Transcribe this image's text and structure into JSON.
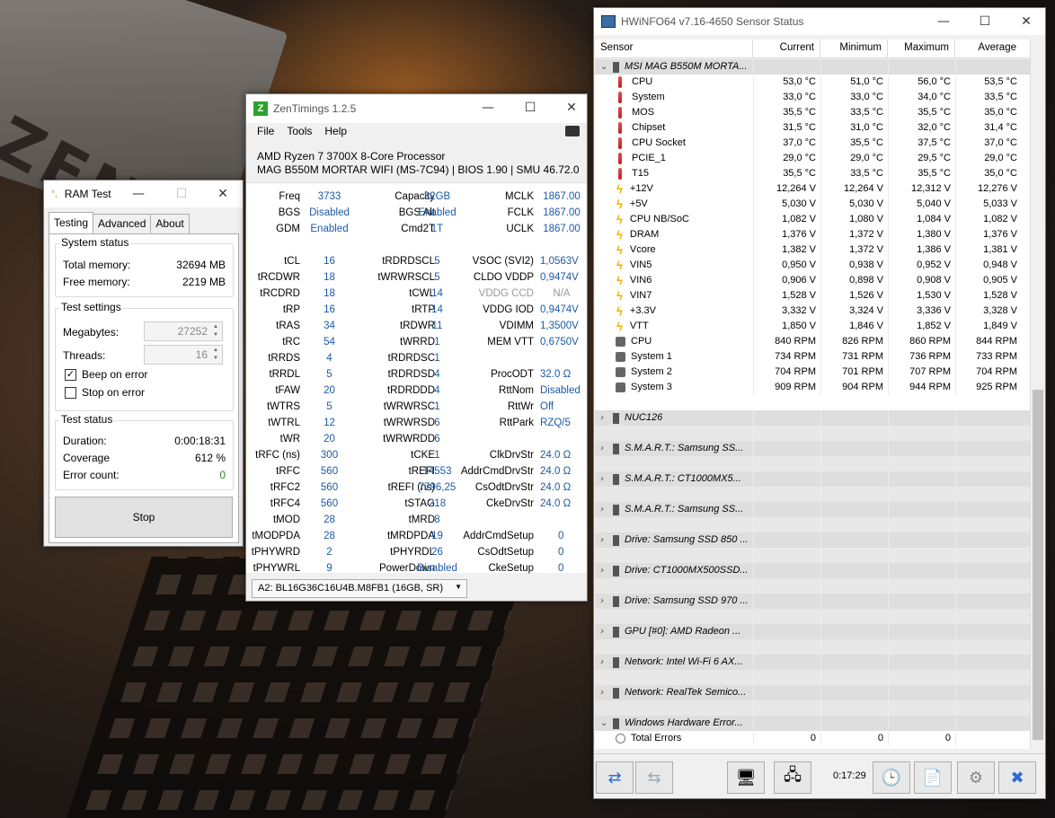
{
  "ramtest": {
    "title": "RAM Test",
    "tabs": [
      "Testing",
      "Advanced",
      "About"
    ],
    "system_status": {
      "title": "System status",
      "total_label": "Total memory:",
      "total_value": "32694 MB",
      "free_label": "Free memory:",
      "free_value": "2219 MB"
    },
    "settings": {
      "title": "Test settings",
      "mb_label": "Megabytes:",
      "mb_value": "27252",
      "threads_label": "Threads:",
      "threads_value": "16",
      "beep_label": "Beep on error",
      "beep_checked": true,
      "stop_label": "Stop on error",
      "stop_checked": false
    },
    "status": {
      "title": "Test status",
      "dur_label": "Duration:",
      "dur_value": "0:00:18:31",
      "cov_label": "Coverage",
      "cov_value": "612 %",
      "err_label": "Error count:",
      "err_value": "0"
    },
    "stop_button": "Stop"
  },
  "zen": {
    "title": "ZenTimings 1.2.5",
    "menu": [
      "File",
      "Tools",
      "Help"
    ],
    "cpu": "AMD Ryzen 7 3700X 8-Core Processor",
    "board": "MAG B550M MORTAR WIFI (MS-7C94) | BIOS 1.90 | SMU 46.72.0",
    "rows": [
      [
        "Freq",
        "3733",
        "Capacity",
        "32GB",
        "MCLK",
        "1867.00"
      ],
      [
        "BGS",
        "Disabled",
        "BGS Alt",
        "Enabled",
        "FCLK",
        "1867.00"
      ],
      [
        "GDM",
        "Enabled",
        "Cmd2T",
        "1T",
        "UCLK",
        "1867.00"
      ],
      [
        "",
        "",
        "",
        "",
        "",
        ""
      ],
      [
        "tCL",
        "16",
        "tRDRDSCL",
        "5",
        "VSOC (SVI2)",
        "1,0563V"
      ],
      [
        "tRCDWR",
        "18",
        "tWRWRSCL",
        "5",
        "CLDO VDDP",
        "0,9474V"
      ],
      [
        "tRCDRD",
        "18",
        "tCWL",
        "14",
        "VDDG CCD",
        "N/A"
      ],
      [
        "tRP",
        "16",
        "tRTP",
        "14",
        "VDDG IOD",
        "0,9474V"
      ],
      [
        "tRAS",
        "34",
        "tRDWR",
        "11",
        "VDIMM",
        "1,3500V"
      ],
      [
        "tRC",
        "54",
        "tWRRD",
        "1",
        "MEM VTT",
        "0,6750V"
      ],
      [
        "tRRDS",
        "4",
        "tRDRDSC",
        "1",
        "",
        ""
      ],
      [
        "tRRDL",
        "5",
        "tRDRDSD",
        "4",
        "ProcODT",
        "32.0 Ω"
      ],
      [
        "tFAW",
        "20",
        "tRDRDDD",
        "4",
        "RttNom",
        "Disabled"
      ],
      [
        "tWTRS",
        "5",
        "tWRWRSC",
        "1",
        "RttWr",
        "Off"
      ],
      [
        "tWTRL",
        "12",
        "tWRWRSD",
        "6",
        "RttPark",
        "RZQ/5"
      ],
      [
        "tWR",
        "20",
        "tWRWRDD",
        "6",
        "",
        ""
      ],
      [
        "tRFC (ns)",
        "300",
        "tCKE",
        "1",
        "ClkDrvStr",
        "24.0 Ω"
      ],
      [
        "tRFC",
        "560",
        "tREFI",
        "14553",
        "AddrCmdDrvStr",
        "24.0 Ω"
      ],
      [
        "tRFC2",
        "560",
        "tREFI (ns)",
        "7796,25",
        "CsOdtDrvStr",
        "24.0 Ω"
      ],
      [
        "tRFC4",
        "560",
        "tSTAG",
        "218",
        "CkeDrvStr",
        "24.0 Ω"
      ],
      [
        "tMOD",
        "28",
        "tMRD",
        "8",
        "",
        ""
      ],
      [
        "tMODPDA",
        "28",
        "tMRDPDA",
        "19",
        "AddrCmdSetup",
        "0"
      ],
      [
        "tPHYWRD",
        "2",
        "tPHYRDL",
        "26",
        "CsOdtSetup",
        "0"
      ],
      [
        "tPHYWRL",
        "9",
        "PowerDown",
        "Disabled",
        "CkeSetup",
        "0"
      ]
    ],
    "dimm": "A2: BL16G36C16U4B.M8FB1 (16GB, SR)"
  },
  "hw": {
    "title": "HWiNFO64 v7.16-4650 Sensor Status",
    "columns": [
      "Sensor",
      "Current",
      "Minimum",
      "Maximum",
      "Average"
    ],
    "board": "MSI MAG B550M MORTA...",
    "sensors": [
      [
        "t",
        "CPU",
        "53,0 °C",
        "51,0 °C",
        "56,0 °C",
        "53,5 °C"
      ],
      [
        "t",
        "System",
        "33,0 °C",
        "33,0 °C",
        "34,0 °C",
        "33,5 °C"
      ],
      [
        "t",
        "MOS",
        "35,5 °C",
        "33,5 °C",
        "35,5 °C",
        "35,0 °C"
      ],
      [
        "t",
        "Chipset",
        "31,5 °C",
        "31,0 °C",
        "32,0 °C",
        "31,4 °C"
      ],
      [
        "t",
        "CPU Socket",
        "37,0 °C",
        "35,5 °C",
        "37,5 °C",
        "37,0 °C"
      ],
      [
        "t",
        "PCIE_1",
        "29,0 °C",
        "29,0 °C",
        "29,5 °C",
        "29,0 °C"
      ],
      [
        "t",
        "T15",
        "35,5 °C",
        "33,5 °C",
        "35,5 °C",
        "35,0 °C"
      ],
      [
        "v",
        "+12V",
        "12,264 V",
        "12,264 V",
        "12,312 V",
        "12,276 V"
      ],
      [
        "v",
        "+5V",
        "5,030 V",
        "5,030 V",
        "5,040 V",
        "5,033 V"
      ],
      [
        "v",
        "CPU NB/SoC",
        "1,082 V",
        "1,080 V",
        "1,084 V",
        "1,082 V"
      ],
      [
        "v",
        "DRAM",
        "1,376 V",
        "1,372 V",
        "1,380 V",
        "1,376 V"
      ],
      [
        "v",
        "Vcore",
        "1,382 V",
        "1,372 V",
        "1,386 V",
        "1,381 V"
      ],
      [
        "v",
        "VIN5",
        "0,950 V",
        "0,938 V",
        "0,952 V",
        "0,948 V"
      ],
      [
        "v",
        "VIN6",
        "0,906 V",
        "0,898 V",
        "0,908 V",
        "0,905 V"
      ],
      [
        "v",
        "VIN7",
        "1,528 V",
        "1,526 V",
        "1,530 V",
        "1,528 V"
      ],
      [
        "v",
        "+3.3V",
        "3,332 V",
        "3,324 V",
        "3,336 V",
        "3,328 V"
      ],
      [
        "v",
        "VTT",
        "1,850 V",
        "1,846 V",
        "1,852 V",
        "1,849 V"
      ],
      [
        "f",
        "CPU",
        "840 RPM",
        "826 RPM",
        "860 RPM",
        "844 RPM"
      ],
      [
        "f",
        "System 1",
        "734 RPM",
        "731 RPM",
        "736 RPM",
        "733 RPM"
      ],
      [
        "f",
        "System 2",
        "704 RPM",
        "701 RPM",
        "707 RPM",
        "704 RPM"
      ],
      [
        "f",
        "System 3",
        "909 RPM",
        "904 RPM",
        "944 RPM",
        "925 RPM"
      ]
    ],
    "groups": [
      "NUC126",
      "S.M.A.R.T.: Samsung SS...",
      "S.M.A.R.T.: CT1000MX5...",
      "S.M.A.R.T.: Samsung SS...",
      "Drive: Samsung SSD 850 ...",
      "Drive: CT1000MX500SSD...",
      "Drive: Samsung SSD 970 ...",
      "GPU [#0]: AMD Radeon ...",
      "Network: Intel Wi-Fi 6 AX...",
      "Network: RealTek Semico...",
      "Windows Hardware Error..."
    ],
    "errors": [
      "Total Errors",
      "0",
      "0",
      "0",
      ""
    ],
    "timer": "0:17:29"
  }
}
